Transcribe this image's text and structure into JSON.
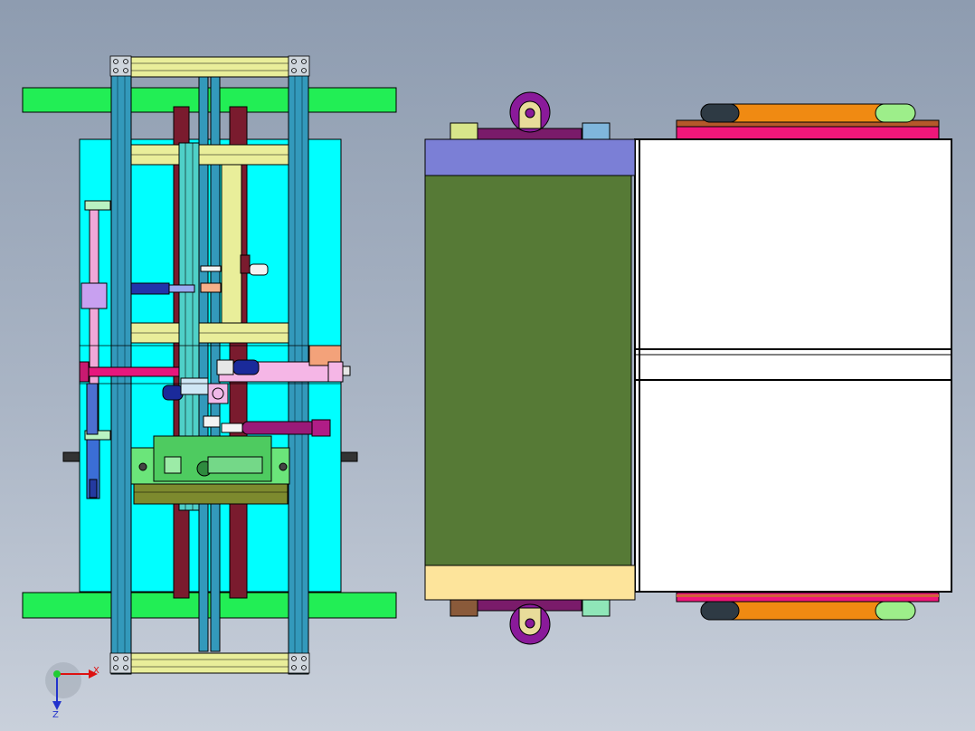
{
  "viewport": {
    "background_top": "#8e9cb0",
    "background_bottom": "#c9d0db"
  },
  "triad": {
    "x_label": "X",
    "z_label": "Z"
  },
  "colors": {
    "cyan_plate": "#00ffff",
    "green_bar": "#22ee55",
    "profile_blue": "#3399bb",
    "profile_yellow": "#e9ee9a",
    "maroon": "#7a1b2e",
    "olive_panel": "#567a36",
    "lavender_panel": "#7b7fd6",
    "cream_panel": "#fde49b",
    "magenta": "#e6177d",
    "orange_roller": "#f08a12",
    "purple_mount": "#8a1a9a"
  }
}
